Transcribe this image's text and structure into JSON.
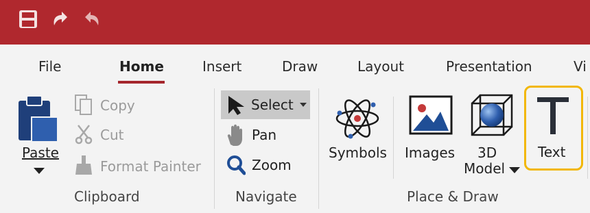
{
  "quick_access": {
    "save_icon": "save-icon",
    "undo_icon": "undo-icon",
    "redo_icon": "redo-icon"
  },
  "colors": {
    "titlebar": "#b0282e",
    "accent_underline": "#a4262c",
    "highlight_border": "#f2b705",
    "icon_blue": "#1f4e96",
    "select_bg": "#c9c9c9"
  },
  "tabs": [
    {
      "label": "File"
    },
    {
      "label": "Home"
    },
    {
      "label": "Insert"
    },
    {
      "label": "Draw"
    },
    {
      "label": "Layout"
    },
    {
      "label": "Presentation"
    },
    {
      "label": "Vi"
    }
  ],
  "active_tab": "Home",
  "ribbon": {
    "clipboard": {
      "group_label": "Clipboard",
      "paste": "Paste",
      "copy": "Copy",
      "cut": "Cut",
      "format_painter": "Format Painter"
    },
    "navigate": {
      "group_label": "Navigate",
      "select": "Select",
      "pan": "Pan",
      "zoom": "Zoom"
    },
    "place_draw": {
      "group_label": "Place & Draw",
      "symbols": "Symbols",
      "images": "Images",
      "model_3d_line1": "3D",
      "model_3d_line2": "Model",
      "text": "Text"
    }
  }
}
